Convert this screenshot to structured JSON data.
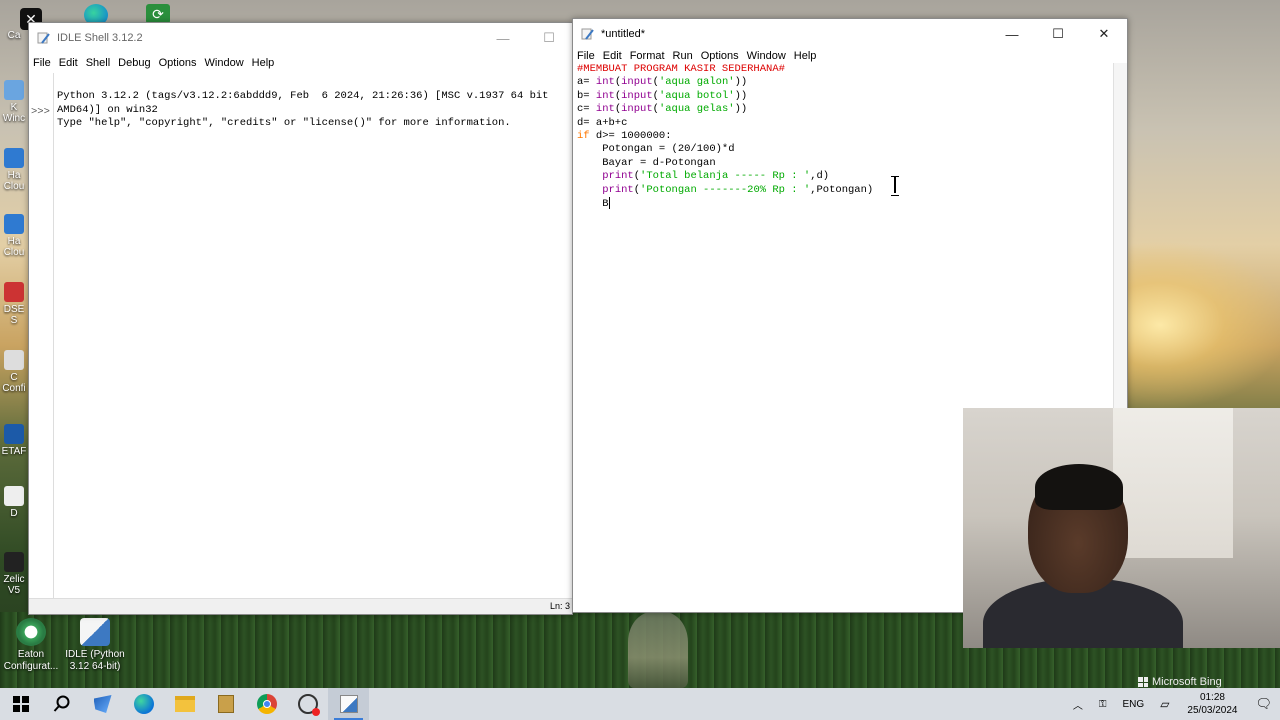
{
  "desktop": {
    "left_icons": [
      {
        "label": "Ca"
      },
      {
        "label": "K\nWinc"
      },
      {
        "label": "Ha\nClou"
      },
      {
        "label": "Ha\nClou"
      },
      {
        "label": "DSE\nS"
      },
      {
        "label": "C\nConfi"
      },
      {
        "label": "ETAF"
      },
      {
        "label": "D"
      },
      {
        "label": "Zelic\nV5"
      }
    ],
    "bottom_icons": [
      {
        "label": "Eaton\nConfigurat..."
      },
      {
        "label": "IDLE (Python\n3.12 64-bit)"
      }
    ]
  },
  "shell_window": {
    "title": "IDLE Shell 3.12.2",
    "menu": [
      "File",
      "Edit",
      "Shell",
      "Debug",
      "Options",
      "Window",
      "Help"
    ],
    "output_lines": [
      "Python 3.12.2 (tags/v3.12.2:6abddd9, Feb  6 2024, 21:26:36) [MSC v.1937 64 bit",
      "AMD64)] on win32",
      "Type \"help\", \"copyright\", \"credits\" or \"license()\" for more information."
    ],
    "prompt": ">>>",
    "status": "Ln: 3"
  },
  "editor_window": {
    "title": "*untitled*",
    "menu": [
      "File",
      "Edit",
      "Format",
      "Run",
      "Options",
      "Window",
      "Help"
    ],
    "code_lines": [
      "#MEMBUAT PROGRAM KASIR SEDERHANA#",
      "a= int(input('aqua galon'))",
      "b= int(input('aqua botol'))",
      "c= int(input('aqua gelas'))",
      "d= a+b+c",
      "if d>= 1000000:",
      "    Potongan = (20/100)*d",
      "    Bayar = d-Potongan",
      "    print('Total belanja ----- Rp : ',d)",
      "    print('Potongan -------20% Rp : ',Potongan)",
      "    B"
    ]
  },
  "webcam": {
    "watermark": "Microsoft Bing"
  },
  "taskbar": {
    "language": "ENG",
    "time": "01:28",
    "date": "25/03/2024"
  },
  "colors": {
    "comment": "#dd0000",
    "keyword": "#ff7700",
    "builtin": "#900090",
    "string": "#00aa00",
    "taskbar_bg": "#d9dde3"
  }
}
